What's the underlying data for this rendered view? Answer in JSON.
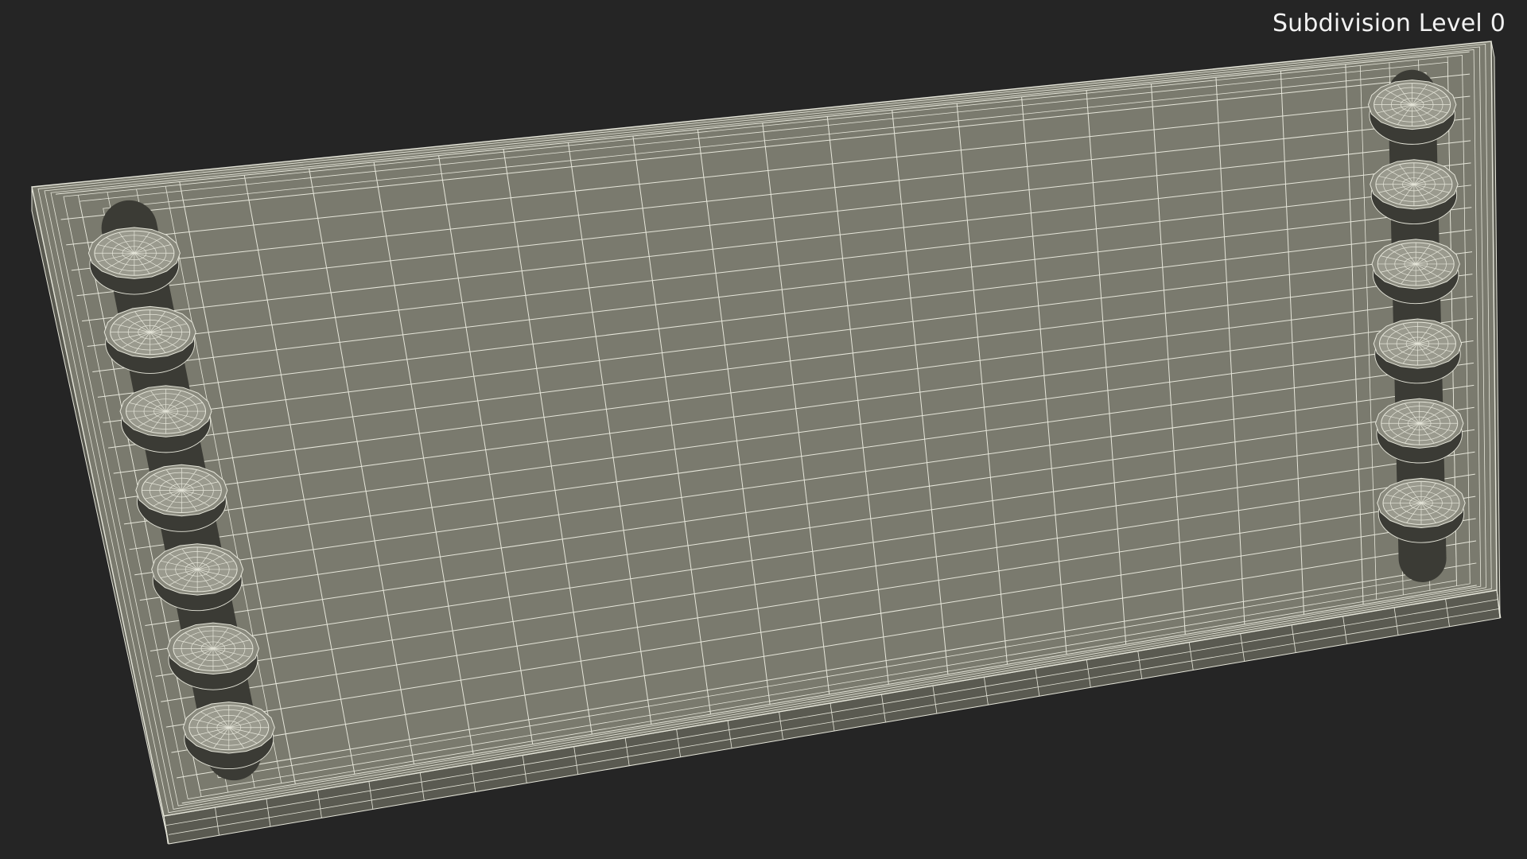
{
  "viewport": {
    "overlay_label": "Subdivision Level 0",
    "background_color": "#252525"
  },
  "model": {
    "description_icon": "wireframe-board-model",
    "colors": {
      "top_face": "#7a7a6e",
      "side_face": "#5a5a51",
      "well_shadow": "#3b3b35",
      "wire": "#e6e6da",
      "hole_rim": "#8a8a7e"
    },
    "left_holes": 7,
    "right_holes": 6,
    "grid_columns": 18,
    "grid_rows": 24
  }
}
